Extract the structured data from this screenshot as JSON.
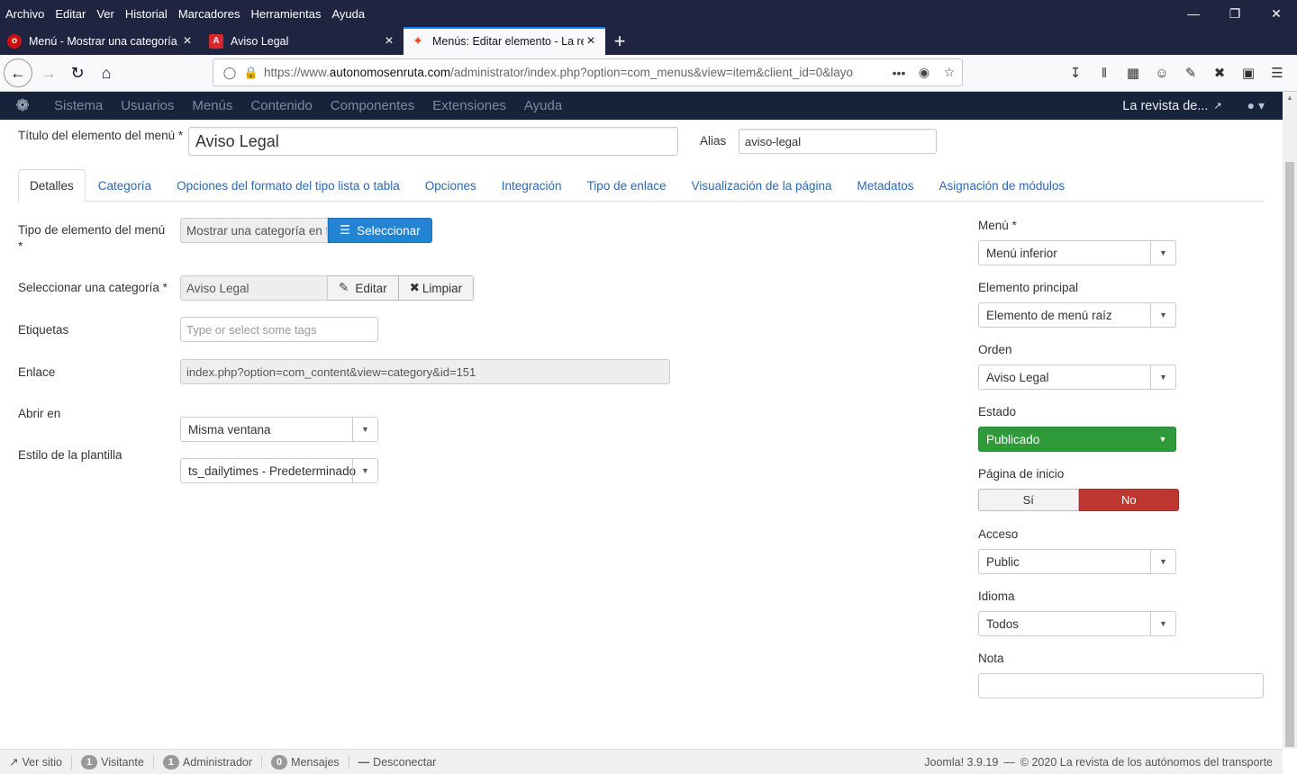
{
  "menubar": {
    "items": [
      "Archivo",
      "Editar",
      "Ver",
      "Historial",
      "Marcadores",
      "Herramientas",
      "Ayuda"
    ]
  },
  "tabs": [
    {
      "label": "Menú - Mostrar una categoría",
      "icon": "opera-icon",
      "color": "#cc1111"
    },
    {
      "label": "Aviso Legal",
      "icon": "acrobat-icon",
      "color": "#d7282f"
    },
    {
      "label": "Menús: Editar elemento - La re",
      "icon": "joomla-icon",
      "color": "#f44321"
    }
  ],
  "url": {
    "prefix": "https://www.",
    "domain": "autonomosenruta.com",
    "path": "/administrator/index.php?option=com_menus&view=item&client_id=0&layo"
  },
  "joomla_nav": {
    "items": [
      "Sistema",
      "Usuarios",
      "Menús",
      "Contenido",
      "Componentes",
      "Extensiones",
      "Ayuda"
    ],
    "site_name": "La revista de..."
  },
  "form": {
    "title_label": "Título del elemento del menú *",
    "title_value": "Aviso Legal",
    "alias_label": "Alias",
    "alias_value": "aviso-legal"
  },
  "form_tabs": [
    "Detalles",
    "Categoría",
    "Opciones del formato del tipo lista o tabla",
    "Opciones",
    "Integración",
    "Tipo de enlace",
    "Visualización de la página",
    "Metadatos",
    "Asignación de módulos"
  ],
  "fields": {
    "tipo": {
      "label": "Tipo de elemento del menú *",
      "value": "Mostrar una categoría en f",
      "button": "Seleccionar"
    },
    "categoria": {
      "label": "Seleccionar una categoría *",
      "value": "Aviso Legal",
      "edit": "Editar",
      "clear": "Limpiar"
    },
    "etiquetas": {
      "label": "Etiquetas",
      "placeholder": "Type or select some tags"
    },
    "enlace": {
      "label": "Enlace",
      "value": "index.php?option=com_content&view=category&id=151"
    },
    "abrir": {
      "label": "Abrir en",
      "value": "Misma ventana"
    },
    "estilo": {
      "label": "Estilo de la plantilla",
      "value": "ts_dailytimes - Predeterminado"
    }
  },
  "side": {
    "menu": {
      "label": "Menú *",
      "value": "Menú inferior"
    },
    "principal": {
      "label": "Elemento principal",
      "value": "Elemento de menú raíz"
    },
    "orden": {
      "label": "Orden",
      "value": "Aviso Legal"
    },
    "estado": {
      "label": "Estado",
      "value": "Publicado"
    },
    "inicio": {
      "label": "Página de inicio",
      "yes": "Sí",
      "no": "No"
    },
    "acceso": {
      "label": "Acceso",
      "value": "Public"
    },
    "idioma": {
      "label": "Idioma",
      "value": "Todos"
    },
    "nota": {
      "label": "Nota"
    }
  },
  "status": {
    "ver_sitio": "Ver sitio",
    "visitantes_count": "1",
    "visitantes": "Visitante",
    "admin_count": "1",
    "admin": "Administrador",
    "mensajes_count": "0",
    "mensajes": "Mensajes",
    "desconectar": "Desconectar",
    "version": "Joomla! 3.9.19",
    "copyright": "© 2020 La revista de los autónomos del transporte"
  },
  "colors": {
    "joomla_header": "#17233b",
    "link": "#2a69b8",
    "primary_button": "#2384d3",
    "published": "#2f9a3a",
    "no_active": "#bd362f"
  }
}
